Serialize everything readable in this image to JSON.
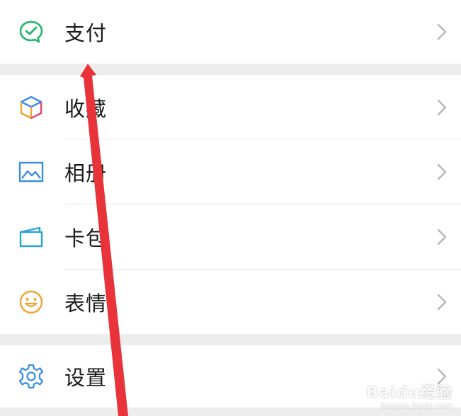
{
  "menu": {
    "pay": {
      "label": "支付",
      "icon": "wechat-pay-icon",
      "color": "#20b86a"
    },
    "favorites": {
      "label": "收藏",
      "icon": "cube-icon"
    },
    "album": {
      "label": "相册",
      "icon": "image-icon",
      "color": "#3a8ee6"
    },
    "cards": {
      "label": "卡包",
      "icon": "wallet-icon",
      "color": "#2aa2d8"
    },
    "stickers": {
      "label": "表情",
      "icon": "smiley-icon",
      "color": "#f0a232"
    },
    "settings": {
      "label": "设置",
      "icon": "gear-icon",
      "color": "#3a8ee6"
    }
  },
  "annotation": {
    "arrow_color": "#e8333a"
  },
  "watermark": {
    "main": "Baidu经验",
    "sub": "jingyan.baidu.com"
  }
}
